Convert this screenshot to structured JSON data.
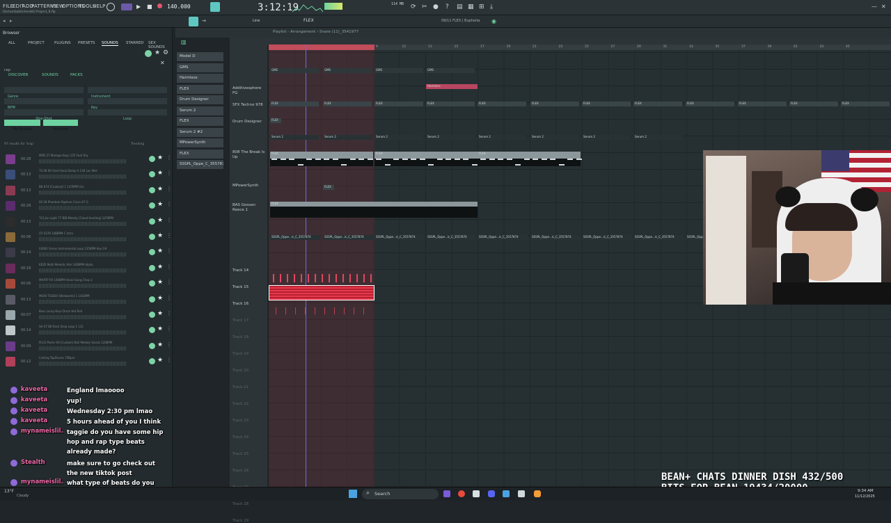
{
  "menu": {
    "items": [
      "FILE",
      "EDIT",
      "ADD",
      "PATTERNS",
      "VIEW",
      "OPTIONS",
      "TOOLS",
      "HELP"
    ],
    "project": "[fortumbakitchen84] Project_9.flp"
  },
  "transport": {
    "tempo": "140.000",
    "time": "3:12:19",
    "cpu": "114 MB",
    "pattern": "FLEX",
    "hint": "Line"
  },
  "plugin_info": "09/11 FLEX | Euphoria",
  "browser": {
    "title": "Browser",
    "tabs": [
      "ALL",
      "PROJECT",
      "PLUGINS",
      "PRESETS",
      "SOUNDS",
      "STARRED",
      "SEX SOUNDS"
    ],
    "search_value": "rap",
    "subtabs": [
      "DISCOVER",
      "SOUNDS",
      "PACKS"
    ],
    "filters": [
      "Genre",
      "Instrument",
      "BPM",
      "Key",
      "One-Shot",
      "Loop"
    ],
    "buttons": [
      "My Sounds",
      "Favorites"
    ],
    "results_label": "97 results for 'trap'",
    "sort": "Trending",
    "rows": [
      {
        "dur": "00:28",
        "name": "MRD 27 Mixtape Keys 155 Feat Dry"
      },
      {
        "dur": "00:13",
        "name": "TS 08 06 Vivid Vocal Delay A 130 Loc Wet"
      },
      {
        "dur": "00:13",
        "name": "BB 874 [Cookout] 1 147BPM Gm"
      },
      {
        "dur": "00:26",
        "name": "00 28 Phantom Rapture Cinco 67 G"
      },
      {
        "dur": "00:13",
        "name": "TL5 Jon Light 77 BIB Melody [Cloud Hustling] 147BPM"
      },
      {
        "dur": "00:06",
        "name": "GY 0378 148BPM C Intro"
      },
      {
        "dur": "00:14",
        "name": "03062 Sirens Instrumental Loop 135BPM Key G#"
      },
      {
        "dur": "00:18",
        "name": "KEZE Mutli Melodic Atm 140BPM Alpha"
      },
      {
        "dur": "00:06",
        "name": "MAATP FH 140BPM Vocal Gang Chop 2"
      },
      {
        "dur": "00:13",
        "name": "MSXII TSSDLV [Bellwards] 1 141BPM"
      },
      {
        "dur": "00:07",
        "name": "Bass Lucky Keys Drum Hat Roll"
      },
      {
        "dur": "00:14",
        "name": "SH 07 88 Rash Drop Loop 1 131"
      },
      {
        "dur": "00:09",
        "name": "PLCO Parler 09 [Custom] Bell Melody Vocals 120BPM"
      },
      {
        "dur": "00:12",
        "name": "Cutting TapDrums 75Bpm"
      }
    ]
  },
  "channels": [
    "Model D",
    "GMS",
    "Harmless",
    "FLEX",
    "Drum Designer",
    "Serum 2",
    "FLEX",
    "Serum 2 #2",
    "MPowerSynth",
    "FLEX",
    "SSSPL_Oppe_C_3557874"
  ],
  "playlist": {
    "title": "Playlist - Arrangement › Snare (11)_3541977",
    "ruler": [
      "3",
      "5",
      "7",
      "9",
      "11",
      "13",
      "15",
      "17",
      "19",
      "21",
      "23",
      "25",
      "27",
      "29",
      "31",
      "33",
      "35",
      "37",
      "39",
      "41",
      "43",
      "45"
    ],
    "tracks": [
      {
        "name": "Additivesphere FG"
      },
      {
        "name": "SFX Techno 978"
      },
      {
        "name": "Drum Designer"
      },
      {
        "name": "808 The Break Is Up"
      },
      {
        "name": "MPowerSynth"
      },
      {
        "name": "BAS Gossan Reece 1"
      },
      {
        "name": "Track 14"
      },
      {
        "name": "Track 15"
      },
      {
        "name": "Track 16"
      }
    ],
    "faint_tracks": [
      "Track 17",
      "Track 18",
      "Track 19",
      "Track 20",
      "Track 21",
      "Track 22",
      "Track 23",
      "Track 24",
      "Track 25",
      "Track 26",
      "Track 27",
      "Track 28",
      "Track 29"
    ],
    "clip_labels": {
      "gms": "GMS",
      "harmless": "Harmless",
      "flex": "FLEX",
      "serum": "Serum 2",
      "ssspl": "SSSPL_Oppe...ic_C_3557874"
    }
  },
  "chat": [
    {
      "user": "kaveeta",
      "msg": "England lmaoooo"
    },
    {
      "user": "kaveeta",
      "msg": "yup!"
    },
    {
      "user": "kaveeta",
      "msg": "Wednesday 2:30 pm lmao"
    },
    {
      "user": "kaveeta",
      "msg": "5 hours ahead of you I think"
    },
    {
      "user": "mynameislil...",
      "msg": "taggie do you have some hip hop and rap type beats already made?"
    },
    {
      "user": "Stealth",
      "msg": "make sure to go check out the new tiktok post"
    },
    {
      "user": "mynameislil...",
      "msg": "what type of beats do you have in your collection?"
    }
  ],
  "goals": {
    "line1": "BEAN+ CHATS DINNER DISH 432/500",
    "line2": "BITS FOR BEAN 19434/20000"
  },
  "taskbar": {
    "weather_temp": "13°F",
    "weather_label": "Cloudy",
    "search": "Search",
    "time": "9:34 AM",
    "date": "11/12/2025"
  }
}
